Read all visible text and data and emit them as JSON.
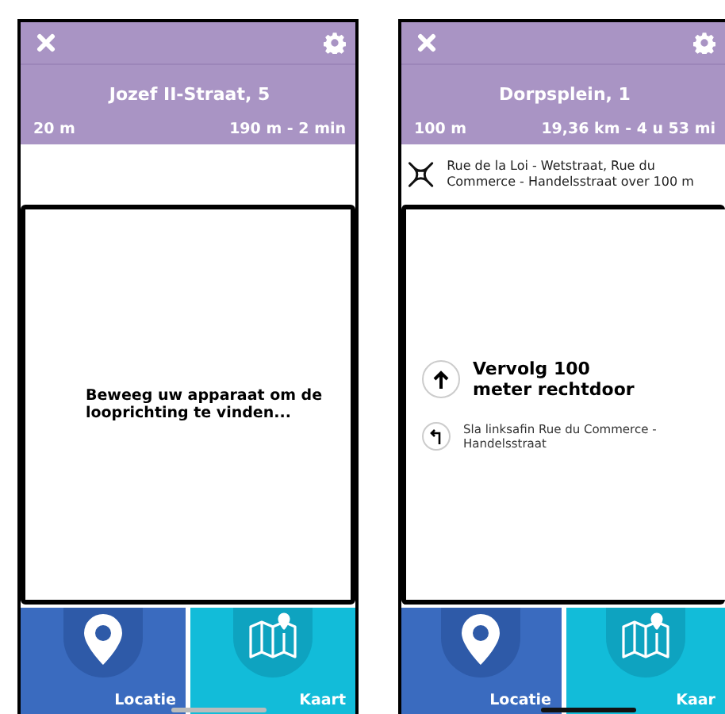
{
  "phones": [
    {
      "header": {
        "title": "Jozef II-Straat, 5",
        "distance": "20 m",
        "remaining": "190 m - 2 min"
      },
      "message": "Beweeg uw apparaat om de looprichting te vinden...",
      "tabs": [
        {
          "label": "Locatie",
          "kind": "location"
        },
        {
          "label": "Kaart",
          "kind": "map"
        }
      ],
      "home_indicator_dark": false
    },
    {
      "header": {
        "title": "Dorpsplein, 1",
        "distance": "100 m",
        "remaining": "19,36 km - 4 u 53 mi"
      },
      "next_maneuver": {
        "kind": "roundabout",
        "text": "Rue de la Loi - Wetstraat, Rue du Commerce - Handelsstraat over 100 m"
      },
      "steps": [
        {
          "kind": "straight",
          "text": "Vervolg 100 meter rechtdoor",
          "main": true
        },
        {
          "kind": "left",
          "text": "Sla linksafin Rue du Commerce - Handelsstraat",
          "main": false
        }
      ],
      "tabs": [
        {
          "label": "Locatie",
          "kind": "location"
        },
        {
          "label": "Kaar",
          "kind": "map"
        }
      ],
      "home_indicator_dark": true
    }
  ]
}
